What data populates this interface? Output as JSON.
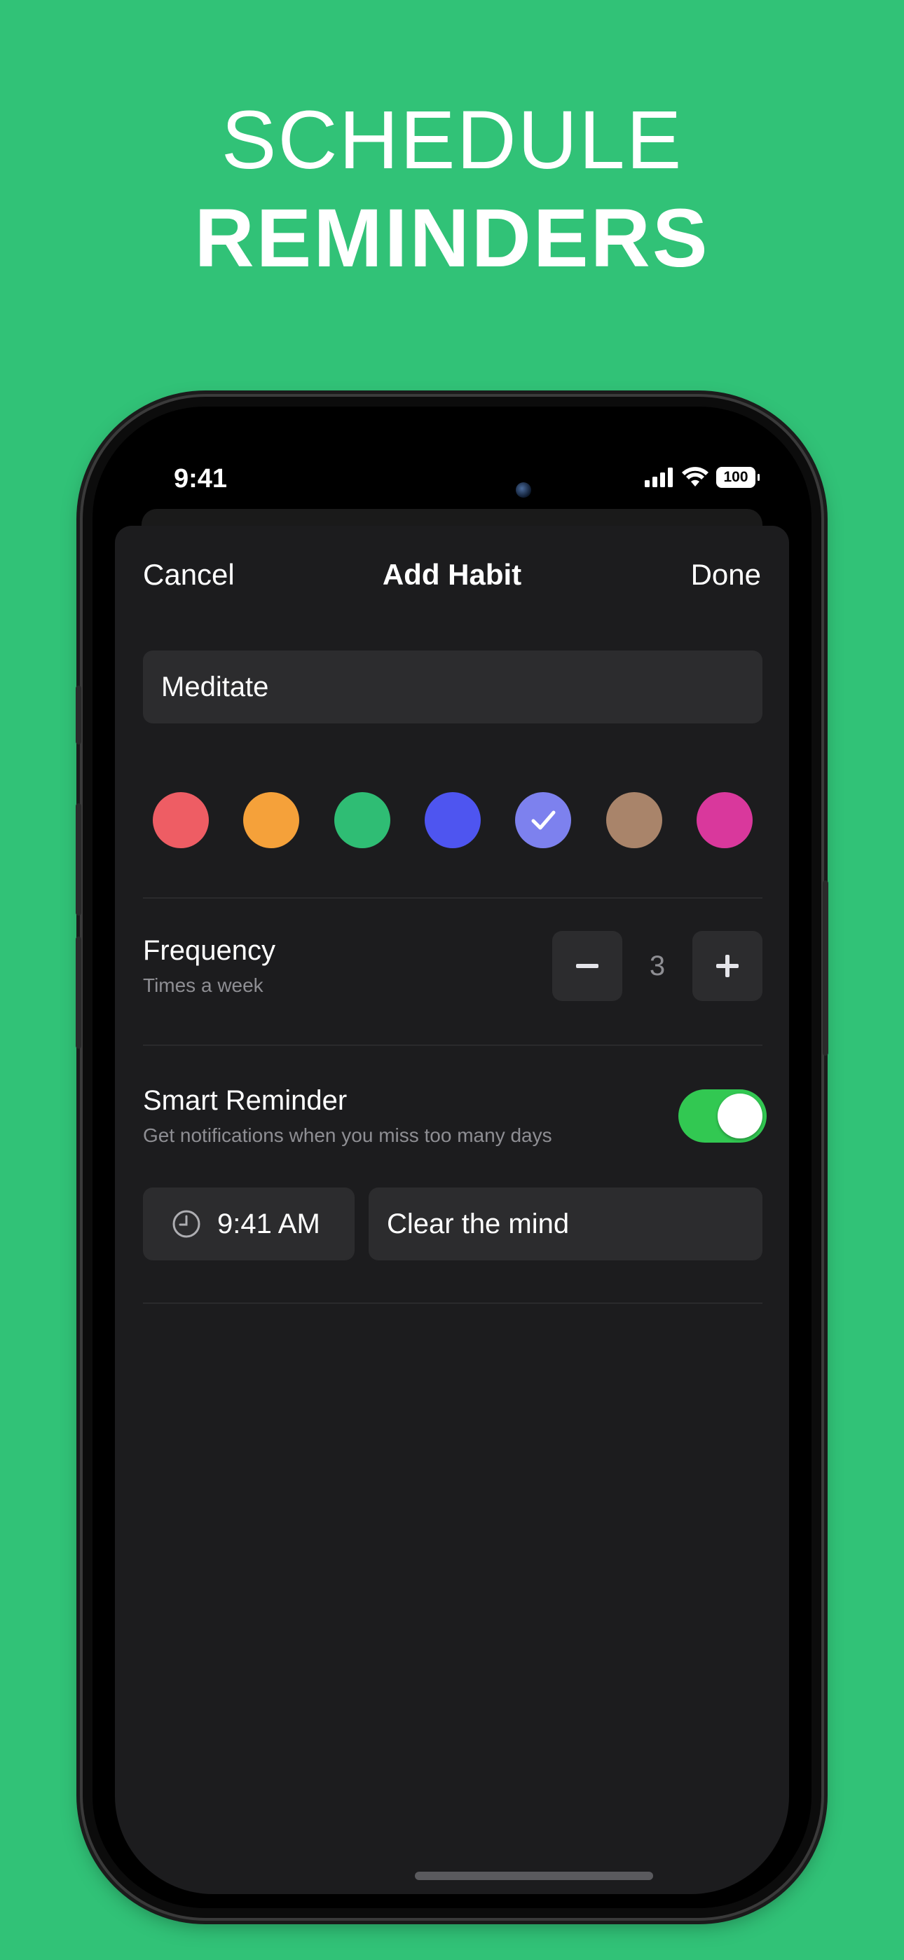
{
  "hero": {
    "line1": "SCHEDULE",
    "line2": "REMINDERS"
  },
  "status_bar": {
    "time": "9:41",
    "battery": "100",
    "icons": [
      "cellular-signal-icon",
      "wifi-icon",
      "battery-icon"
    ]
  },
  "nav": {
    "cancel": "Cancel",
    "title": "Add Habit",
    "done": "Done"
  },
  "habit_name": {
    "value": "Meditate"
  },
  "colors": {
    "options": [
      "#ee5d64",
      "#f5a13a",
      "#2fbd74",
      "#4e55f0",
      "#7d81ee",
      "#a9846a",
      "#d9389c"
    ],
    "selected_index": 4
  },
  "frequency": {
    "title": "Frequency",
    "subtitle": "Times a week",
    "value": "3"
  },
  "smart_reminder": {
    "title": "Smart Reminder",
    "subtitle": "Get notifications when you miss too many days",
    "enabled": true,
    "accent": "#32c852"
  },
  "reminder": {
    "time": "9:41 AM",
    "message": "Clear the mind"
  },
  "theme": {
    "background": "#31c277",
    "sheet": "#1c1c1e",
    "field": "#2c2c2e"
  }
}
